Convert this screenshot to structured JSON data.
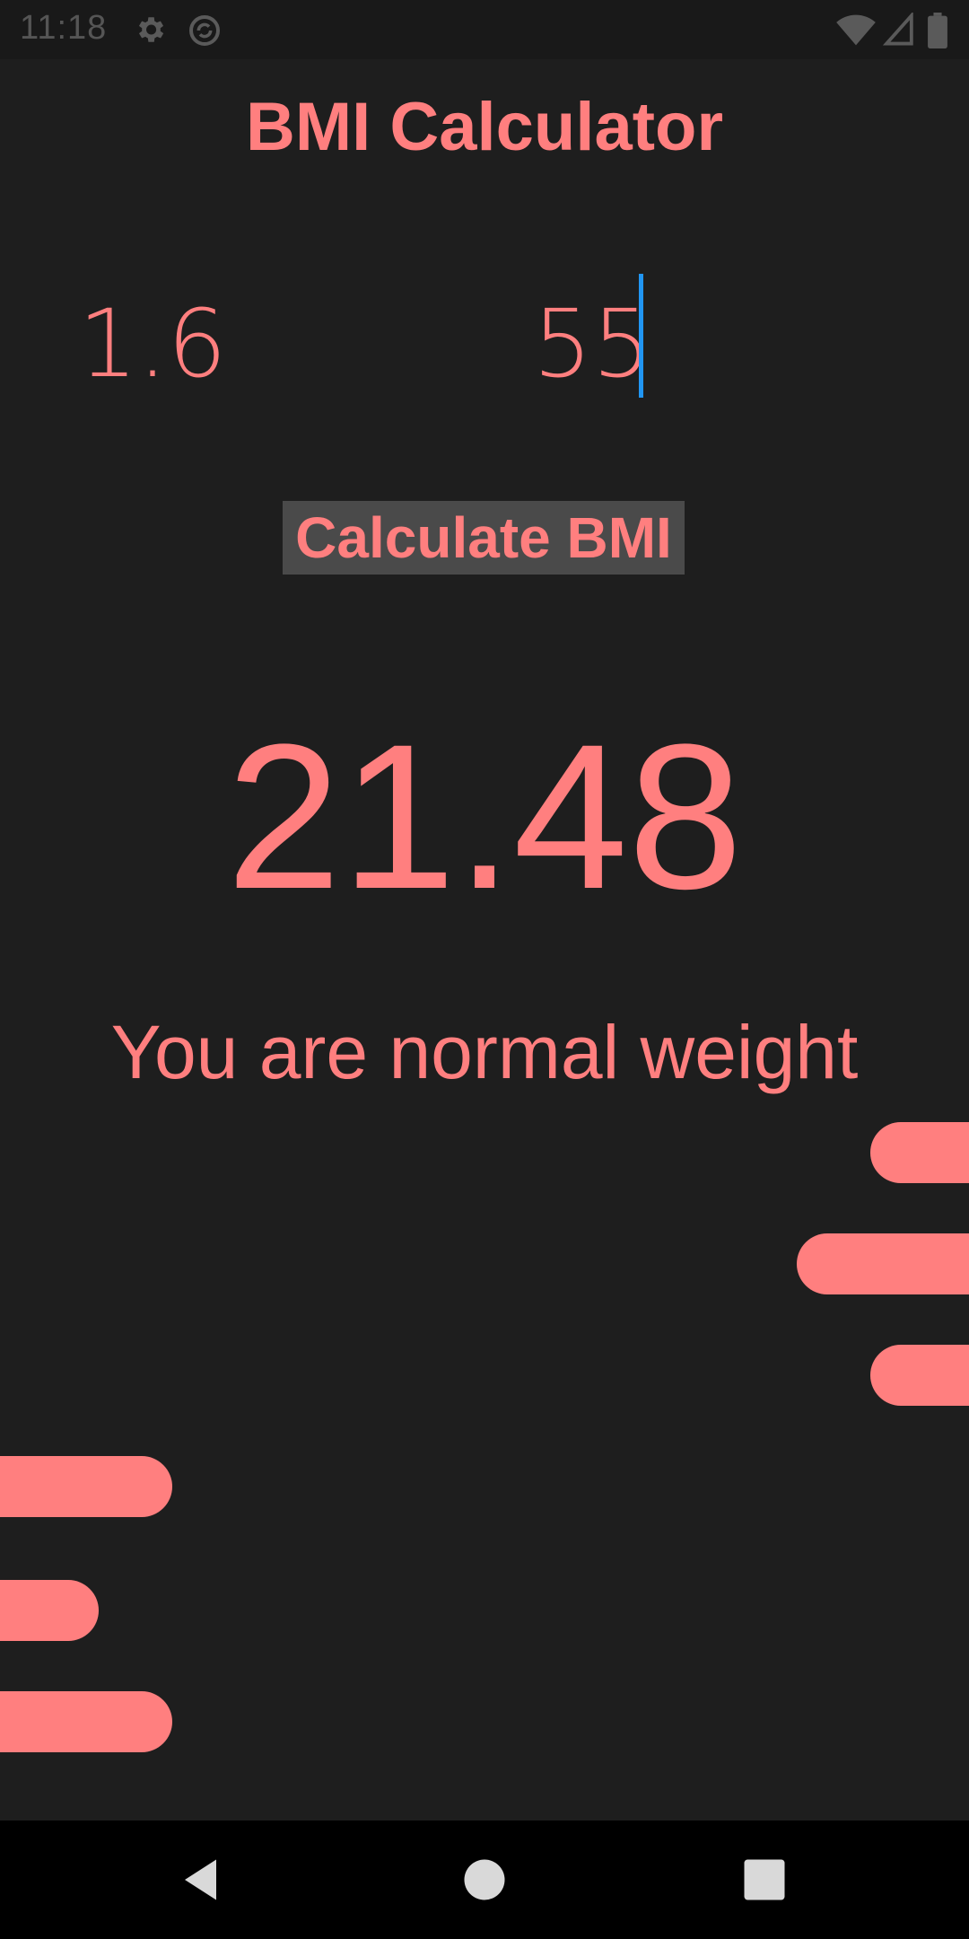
{
  "status_bar": {
    "time": "11:18",
    "icons": [
      "gear-icon",
      "sync-icon",
      "wifi-icon",
      "signal-icon",
      "battery-icon"
    ]
  },
  "app": {
    "title": "BMI Calculator"
  },
  "inputs": {
    "height_value": "1.6",
    "weight_value": "55"
  },
  "calculate_button": {
    "label": "Calculate BMI"
  },
  "result": {
    "bmi": "21.48",
    "message": "You are normal weight"
  },
  "navigation": {
    "items": [
      "back-icon",
      "home-icon",
      "recents-icon"
    ]
  },
  "colors": {
    "background": "#1e1e1e",
    "accent": "#ff7f7f",
    "button_bg": "#4a4a4a",
    "cursor": "#2196f3"
  }
}
